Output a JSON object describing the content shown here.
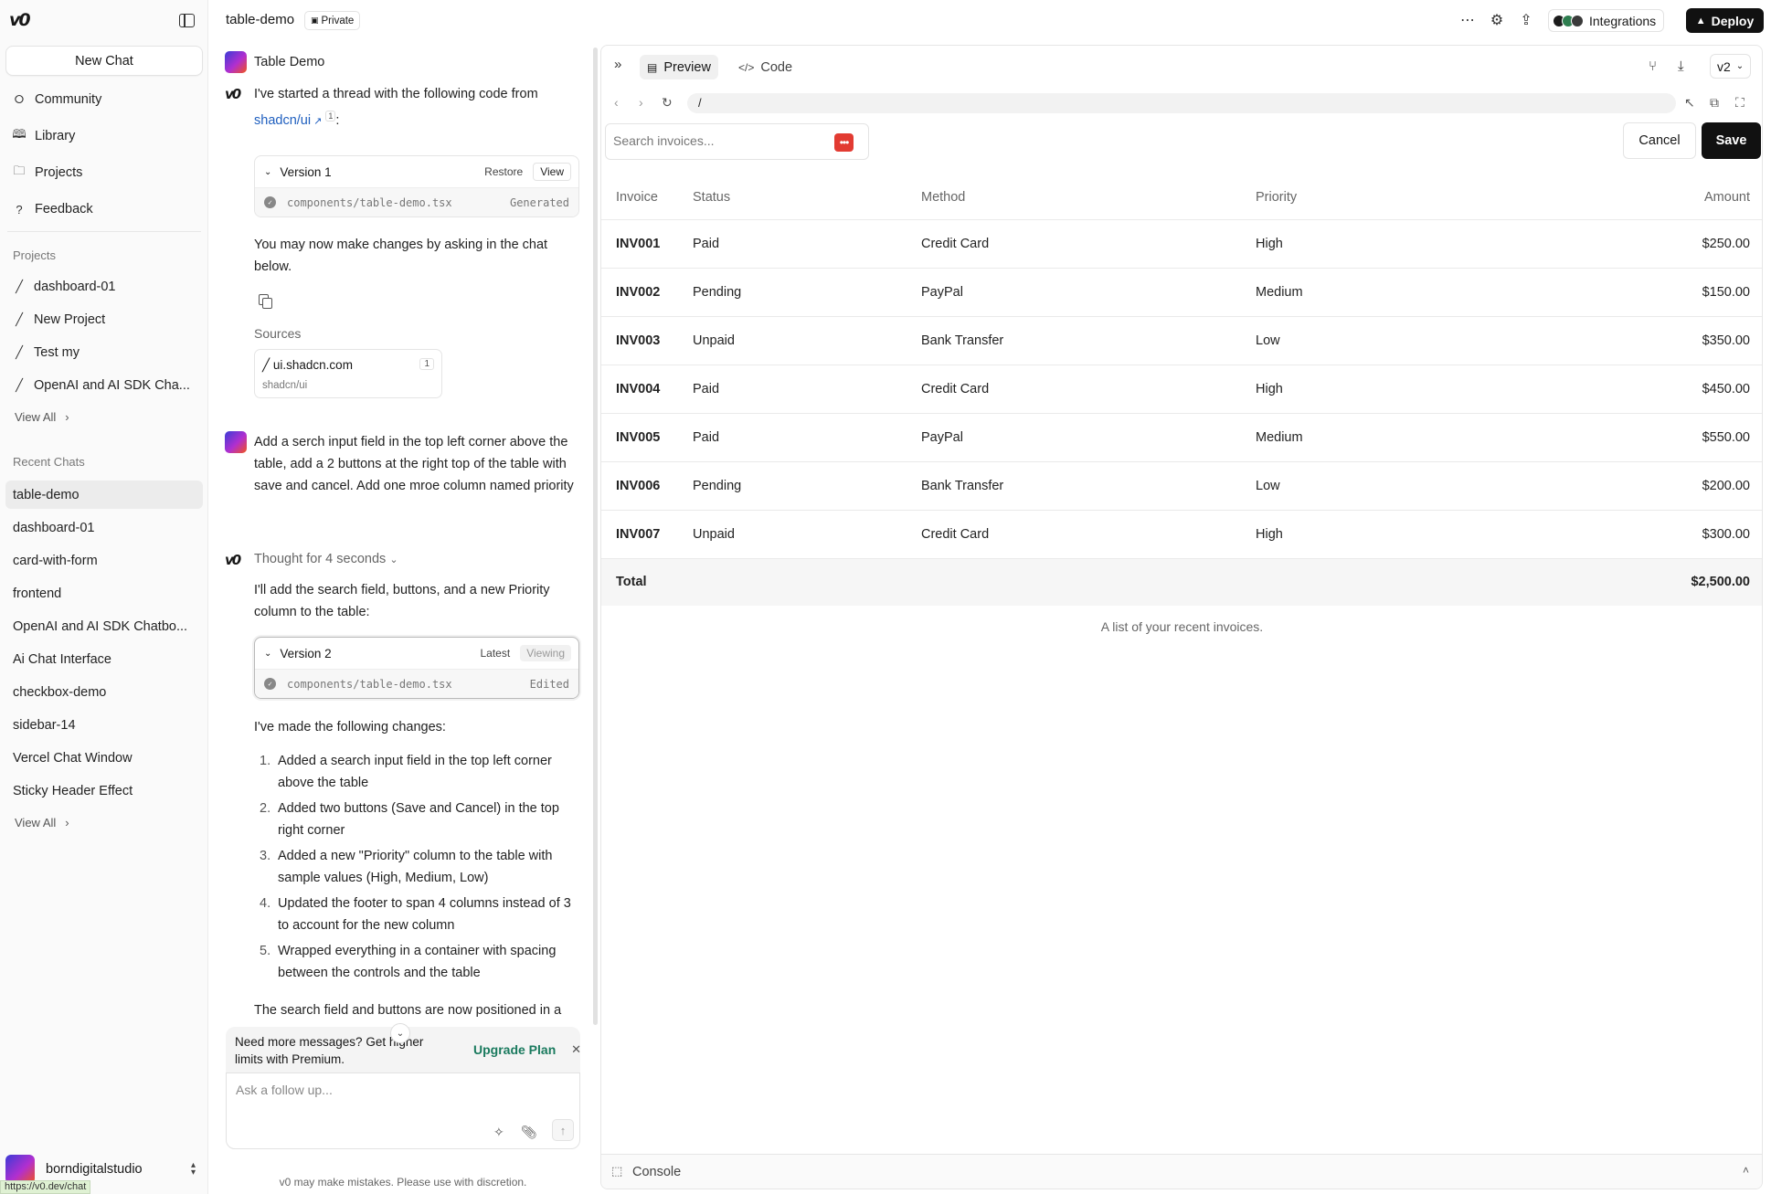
{
  "sidebar": {
    "logo": "v0",
    "new_chat": "New Chat",
    "nav": [
      {
        "label": "Community",
        "icon": "community-icon"
      },
      {
        "label": "Library",
        "icon": "book-icon"
      },
      {
        "label": "Projects",
        "icon": "folder-icon"
      },
      {
        "label": "Feedback",
        "icon": "help-icon"
      }
    ],
    "projects_label": "Projects",
    "projects": [
      "dashboard-01",
      "New Project",
      "Test my",
      "OpenAI and AI SDK Cha..."
    ],
    "view_all": "View All",
    "recent_label": "Recent Chats",
    "recent": [
      "table-demo",
      "dashboard-01",
      "card-with-form",
      "frontend",
      "OpenAI and AI SDK Chatbo...",
      "Ai Chat Interface",
      "checkbox-demo",
      "sidebar-14",
      "Vercel Chat Window",
      "Sticky Header Effect"
    ],
    "user": "borndigitalstudio",
    "status_url": "https://v0.dev/chat"
  },
  "topbar": {
    "title": "table-demo",
    "private": "Private",
    "integrations": "Integrations",
    "deploy": "Deploy"
  },
  "chat": {
    "header_title": "Table Demo",
    "msg1_prefix": "I've started a thread with the following code from",
    "msg1_link": "shadcn/ui",
    "msg1_sup": "1",
    "msg1_suffix": ":",
    "v1": {
      "name": "Version 1",
      "restore": "Restore",
      "view": "View",
      "file": "components/table-demo.tsx",
      "status": "Generated"
    },
    "msg2": "You may now make changes by asking in the chat below.",
    "sources_label": "Sources",
    "source": {
      "title": "ui.shadcn.com",
      "sub": "shadcn/ui",
      "num": "1"
    },
    "user_msg": "Add a serch input field in the top left corner above the table, add a 2 buttons at the right top of the table with save and cancel. Add one mroe column named priority",
    "thought": "Thought for 4 seconds",
    "reply_intro": "I'll add the search field, buttons, and a new Priority column to the table:",
    "v2": {
      "name": "Version 2",
      "latest": "Latest",
      "viewing": "Viewing",
      "file": "components/table-demo.tsx",
      "status": "Edited"
    },
    "changes_intro": "I've made the following changes:",
    "changes": [
      "Added a search input field in the top left corner above the table",
      "Added two buttons (Save and Cancel) in the top right corner",
      "Added a new \"Priority\" column to the table with sample values (High, Medium, Low)",
      "Updated the footer to span 4 columns instead of 3 to account for the new column",
      "Wrapped everything in a container with spacing between the controls and the table"
    ],
    "tail": "The search field and buttons are now positioned in a",
    "upgrade_text": "Need more messages? Get higher limits with Premium.",
    "upgrade_cta": "Upgrade Plan",
    "composer_placeholder": "Ask a follow up...",
    "disclaimer": "v0 may make mistakes. Please use with discretion."
  },
  "preview": {
    "tab_preview": "Preview",
    "tab_code": "Code",
    "version": "v2",
    "url": "/",
    "search_placeholder": "Search invoices...",
    "cancel": "Cancel",
    "save": "Save",
    "columns": [
      "Invoice",
      "Status",
      "Method",
      "Priority",
      "Amount"
    ],
    "rows": [
      [
        "INV001",
        "Paid",
        "Credit Card",
        "High",
        "$250.00"
      ],
      [
        "INV002",
        "Pending",
        "PayPal",
        "Medium",
        "$150.00"
      ],
      [
        "INV003",
        "Unpaid",
        "Bank Transfer",
        "Low",
        "$350.00"
      ],
      [
        "INV004",
        "Paid",
        "Credit Card",
        "High",
        "$450.00"
      ],
      [
        "INV005",
        "Paid",
        "PayPal",
        "Medium",
        "$550.00"
      ],
      [
        "INV006",
        "Pending",
        "Bank Transfer",
        "Low",
        "$200.00"
      ],
      [
        "INV007",
        "Unpaid",
        "Credit Card",
        "High",
        "$300.00"
      ]
    ],
    "total_label": "Total",
    "total_value": "$2,500.00",
    "caption": "A list of your recent invoices.",
    "console": "Console"
  }
}
